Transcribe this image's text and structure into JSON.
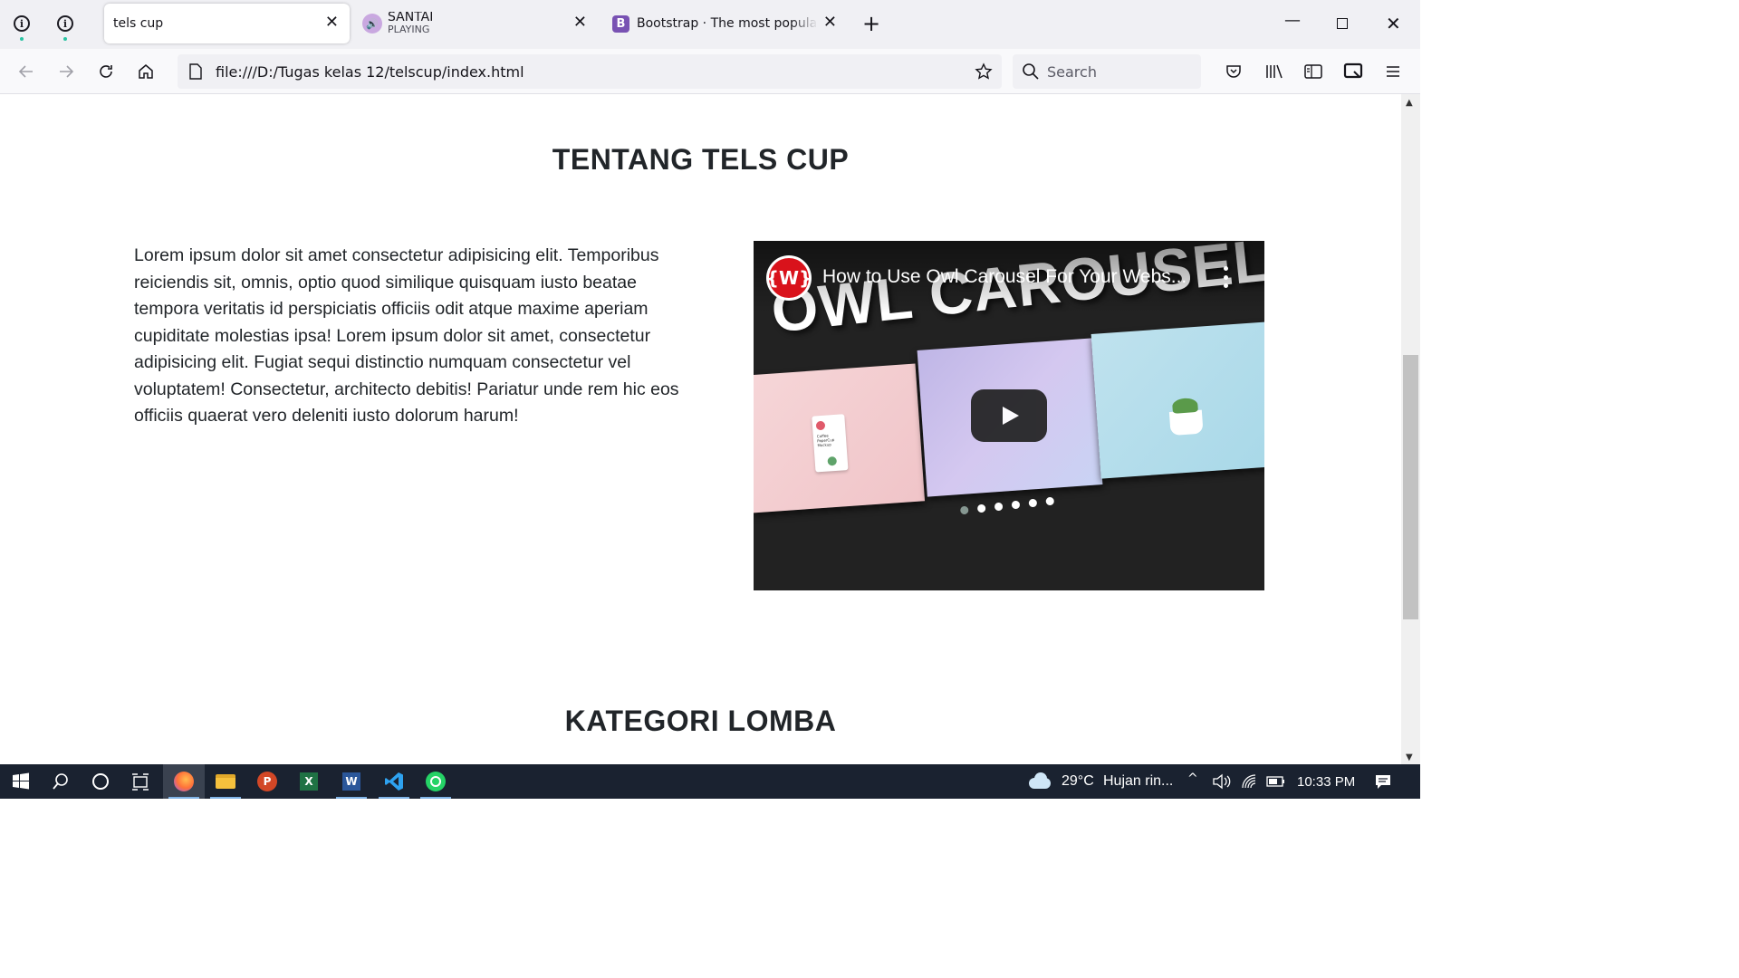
{
  "browser": {
    "tabs": [
      {
        "label": "tels cup",
        "active": true
      },
      {
        "label": "SANTAI",
        "sublabel": "PLAYING",
        "active": false
      },
      {
        "label": "Bootstrap · The most popular HTML",
        "active": false
      }
    ],
    "url": "file:///D:/Tugas kelas 12/telscup/index.html",
    "search_placeholder": "Search"
  },
  "page": {
    "section1_title": "TENTANG TELS CUP",
    "about_text": "Lorem ipsum dolor sit amet consectetur adipisicing elit. Temporibus reiciendis sit, omnis, optio quod similique quisquam iusto beatae tempora veritatis id perspiciatis officiis odit atque maxime aperiam cupiditate molestias ipsa! Lorem ipsum dolor sit amet, consectetur adipisicing elit. Fugiat sequi distinctio numquam consectetur vel voluptatem! Consectetur, architecto debitis! Pariatur unde rem hic eos officiis quaerat vero deleniti iusto dolorum harum!",
    "video": {
      "channel_logo_text": "{W}",
      "title": "How to Use Owl Carousel For Your Webs...",
      "thumbnail_text": "OWL CAROUSEL",
      "card_label": "Coffee PaperCup Mockup"
    },
    "section2_title": "KATEGORI LOMBA"
  },
  "taskbar": {
    "weather_temp": "29°C",
    "weather_desc": "Hujan rin...",
    "time": "10:33 PM"
  },
  "colors": {
    "heading": "#212529",
    "video_bg": "#222222",
    "channel_red": "#d9121b",
    "taskbar_bg": "#1a2230"
  }
}
